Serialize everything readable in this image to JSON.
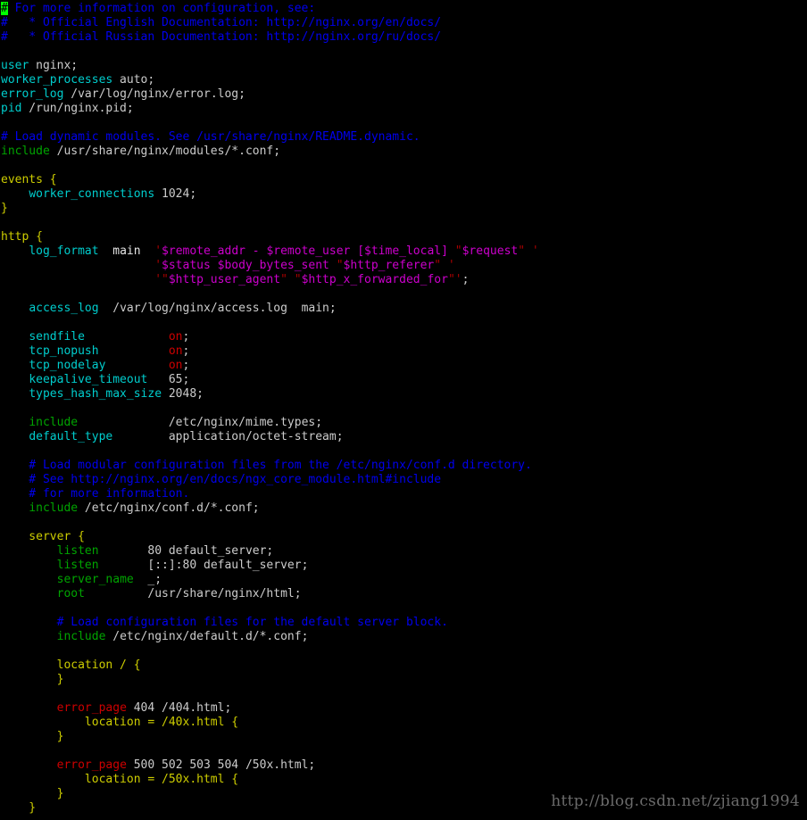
{
  "window": {
    "background_color": "#000000",
    "foreground_color": "#cccccc",
    "cursor_color": "#00ff00",
    "kind": "terminal-text-editor",
    "content_description": "nginx.conf viewed in a terminal editor with syntax highlighting"
  },
  "palette": {
    "comment": "#0000ee",
    "keyword_cyan": "#00cdcd",
    "directive_green": "#00a400",
    "block_yellow": "#cdcd00",
    "string_magenta": "#cd00cd",
    "quote_darkred": "#aa0000",
    "value_red": "#cd0000",
    "plain": "#cccccc",
    "cursor_bg": "#00ff00",
    "watermark": "#6b6b6b"
  },
  "cursor": {
    "char": "#",
    "line": 1,
    "column": 1
  },
  "watermark": {
    "text": "http://blog.csdn.net/zjiang1994"
  },
  "lines": [
    {
      "segs": [
        {
          "t": "#",
          "c": "cursor"
        },
        {
          "t": " For more information on configuration, see:",
          "c": "c-comment"
        }
      ]
    },
    {
      "segs": [
        {
          "t": "#   * Official English Documentation: http://nginx.org/en/docs/",
          "c": "c-comment"
        }
      ]
    },
    {
      "segs": [
        {
          "t": "#   * Official Russian Documentation: http://nginx.org/ru/docs/",
          "c": "c-comment"
        }
      ]
    },
    {
      "segs": [
        {
          "t": "",
          "c": "c-plain"
        }
      ]
    },
    {
      "segs": [
        {
          "t": "user",
          "c": "c-keyword"
        },
        {
          "t": " nginx;",
          "c": "c-plain"
        }
      ]
    },
    {
      "segs": [
        {
          "t": "worker_processes",
          "c": "c-keyword"
        },
        {
          "t": " auto;",
          "c": "c-plain"
        }
      ]
    },
    {
      "segs": [
        {
          "t": "error_log",
          "c": "c-keyword"
        },
        {
          "t": " /var/log/nginx/error.log;",
          "c": "c-plain"
        }
      ]
    },
    {
      "segs": [
        {
          "t": "pid",
          "c": "c-keyword"
        },
        {
          "t": " /run/nginx.pid;",
          "c": "c-plain"
        }
      ]
    },
    {
      "segs": [
        {
          "t": "",
          "c": "c-plain"
        }
      ]
    },
    {
      "segs": [
        {
          "t": "# Load dynamic modules. See /usr/share/nginx/README.dynamic.",
          "c": "c-comment"
        }
      ]
    },
    {
      "segs": [
        {
          "t": "include",
          "c": "c-green"
        },
        {
          "t": " /usr/share/nginx/modules/*.conf;",
          "c": "c-plain"
        }
      ]
    },
    {
      "segs": [
        {
          "t": "",
          "c": "c-plain"
        }
      ]
    },
    {
      "segs": [
        {
          "t": "events {",
          "c": "c-block"
        }
      ]
    },
    {
      "segs": [
        {
          "t": "    ",
          "c": "c-plain"
        },
        {
          "t": "worker_connections",
          "c": "c-keyword"
        },
        {
          "t": " 1024;",
          "c": "c-plain"
        }
      ]
    },
    {
      "segs": [
        {
          "t": "}",
          "c": "c-block"
        }
      ]
    },
    {
      "segs": [
        {
          "t": "",
          "c": "c-plain"
        }
      ]
    },
    {
      "segs": [
        {
          "t": "http {",
          "c": "c-block"
        }
      ]
    },
    {
      "segs": [
        {
          "t": "    ",
          "c": "c-plain"
        },
        {
          "t": "log_format",
          "c": "c-keyword"
        },
        {
          "t": "  main  ",
          "c": "c-white"
        },
        {
          "t": "'",
          "c": "c-quote"
        },
        {
          "t": "$remote_addr - $remote_user [$time_local] ",
          "c": "c-string"
        },
        {
          "t": "\"",
          "c": "c-quote"
        },
        {
          "t": "$request",
          "c": "c-string"
        },
        {
          "t": "\" '",
          "c": "c-quote"
        }
      ]
    },
    {
      "segs": [
        {
          "t": "                      ",
          "c": "c-plain"
        },
        {
          "t": "'",
          "c": "c-quote"
        },
        {
          "t": "$status $body_bytes_sent ",
          "c": "c-string"
        },
        {
          "t": "\"",
          "c": "c-quote"
        },
        {
          "t": "$http_referer",
          "c": "c-string"
        },
        {
          "t": "\" '",
          "c": "c-quote"
        }
      ]
    },
    {
      "segs": [
        {
          "t": "                      ",
          "c": "c-plain"
        },
        {
          "t": "'\"",
          "c": "c-quote"
        },
        {
          "t": "$http_user_agent",
          "c": "c-string"
        },
        {
          "t": "\" \"",
          "c": "c-quote"
        },
        {
          "t": "$http_x_forwarded_for",
          "c": "c-string"
        },
        {
          "t": "\"'",
          "c": "c-quote"
        },
        {
          "t": ";",
          "c": "c-plain"
        }
      ]
    },
    {
      "segs": [
        {
          "t": "",
          "c": "c-plain"
        }
      ]
    },
    {
      "segs": [
        {
          "t": "    ",
          "c": "c-plain"
        },
        {
          "t": "access_log",
          "c": "c-keyword"
        },
        {
          "t": "  /var/log/nginx/access.log  main;",
          "c": "c-plain"
        }
      ]
    },
    {
      "segs": [
        {
          "t": "",
          "c": "c-plain"
        }
      ]
    },
    {
      "segs": [
        {
          "t": "    ",
          "c": "c-plain"
        },
        {
          "t": "sendfile",
          "c": "c-keyword"
        },
        {
          "t": "            ",
          "c": "c-plain"
        },
        {
          "t": "on",
          "c": "c-value"
        },
        {
          "t": ";",
          "c": "c-plain"
        }
      ]
    },
    {
      "segs": [
        {
          "t": "    ",
          "c": "c-plain"
        },
        {
          "t": "tcp_nopush",
          "c": "c-keyword"
        },
        {
          "t": "          ",
          "c": "c-plain"
        },
        {
          "t": "on",
          "c": "c-value"
        },
        {
          "t": ";",
          "c": "c-plain"
        }
      ]
    },
    {
      "segs": [
        {
          "t": "    ",
          "c": "c-plain"
        },
        {
          "t": "tcp_nodelay",
          "c": "c-keyword"
        },
        {
          "t": "         ",
          "c": "c-plain"
        },
        {
          "t": "on",
          "c": "c-value"
        },
        {
          "t": ";",
          "c": "c-plain"
        }
      ]
    },
    {
      "segs": [
        {
          "t": "    ",
          "c": "c-plain"
        },
        {
          "t": "keepalive_timeout",
          "c": "c-keyword"
        },
        {
          "t": "   65;",
          "c": "c-plain"
        }
      ]
    },
    {
      "segs": [
        {
          "t": "    ",
          "c": "c-plain"
        },
        {
          "t": "types_hash_max_size",
          "c": "c-keyword"
        },
        {
          "t": " 2048;",
          "c": "c-plain"
        }
      ]
    },
    {
      "segs": [
        {
          "t": "",
          "c": "c-plain"
        }
      ]
    },
    {
      "segs": [
        {
          "t": "    ",
          "c": "c-plain"
        },
        {
          "t": "include",
          "c": "c-green"
        },
        {
          "t": "             /etc/nginx/mime.types;",
          "c": "c-plain"
        }
      ]
    },
    {
      "segs": [
        {
          "t": "    ",
          "c": "c-plain"
        },
        {
          "t": "default_type",
          "c": "c-keyword"
        },
        {
          "t": "        application/octet-stream;",
          "c": "c-plain"
        }
      ]
    },
    {
      "segs": [
        {
          "t": "",
          "c": "c-plain"
        }
      ]
    },
    {
      "segs": [
        {
          "t": "    # Load modular configuration files from the /etc/nginx/conf.d directory.",
          "c": "c-comment"
        }
      ]
    },
    {
      "segs": [
        {
          "t": "    # See http://nginx.org/en/docs/ngx_core_module.html#include",
          "c": "c-comment"
        }
      ]
    },
    {
      "segs": [
        {
          "t": "    # for more information.",
          "c": "c-comment"
        }
      ]
    },
    {
      "segs": [
        {
          "t": "    ",
          "c": "c-plain"
        },
        {
          "t": "include",
          "c": "c-green"
        },
        {
          "t": " /etc/nginx/conf.d/*.conf;",
          "c": "c-plain"
        }
      ]
    },
    {
      "segs": [
        {
          "t": "",
          "c": "c-plain"
        }
      ]
    },
    {
      "segs": [
        {
          "t": "    server {",
          "c": "c-block"
        }
      ]
    },
    {
      "segs": [
        {
          "t": "        ",
          "c": "c-plain"
        },
        {
          "t": "listen",
          "c": "c-green"
        },
        {
          "t": "       80 default_server;",
          "c": "c-plain"
        }
      ]
    },
    {
      "segs": [
        {
          "t": "        ",
          "c": "c-plain"
        },
        {
          "t": "listen",
          "c": "c-green"
        },
        {
          "t": "       [::]:80 default_server;",
          "c": "c-plain"
        }
      ]
    },
    {
      "segs": [
        {
          "t": "        ",
          "c": "c-plain"
        },
        {
          "t": "server_name",
          "c": "c-green"
        },
        {
          "t": "  _;",
          "c": "c-plain"
        }
      ]
    },
    {
      "segs": [
        {
          "t": "        ",
          "c": "c-plain"
        },
        {
          "t": "root",
          "c": "c-green"
        },
        {
          "t": "         /usr/share/nginx/html;",
          "c": "c-plain"
        }
      ]
    },
    {
      "segs": [
        {
          "t": "",
          "c": "c-plain"
        }
      ]
    },
    {
      "segs": [
        {
          "t": "        # Load configuration files for the default server block.",
          "c": "c-comment"
        }
      ]
    },
    {
      "segs": [
        {
          "t": "        ",
          "c": "c-plain"
        },
        {
          "t": "include",
          "c": "c-green"
        },
        {
          "t": " /etc/nginx/default.d/*.conf;",
          "c": "c-plain"
        }
      ]
    },
    {
      "segs": [
        {
          "t": "",
          "c": "c-plain"
        }
      ]
    },
    {
      "segs": [
        {
          "t": "        location / {",
          "c": "c-block"
        }
      ]
    },
    {
      "segs": [
        {
          "t": "        }",
          "c": "c-block"
        }
      ]
    },
    {
      "segs": [
        {
          "t": "",
          "c": "c-plain"
        }
      ]
    },
    {
      "segs": [
        {
          "t": "        ",
          "c": "c-plain"
        },
        {
          "t": "error_page",
          "c": "c-errpage"
        },
        {
          "t": " 404 /404.html;",
          "c": "c-plain"
        }
      ]
    },
    {
      "segs": [
        {
          "t": "            location = /40x.html {",
          "c": "c-block"
        }
      ]
    },
    {
      "segs": [
        {
          "t": "        }",
          "c": "c-block"
        }
      ]
    },
    {
      "segs": [
        {
          "t": "",
          "c": "c-plain"
        }
      ]
    },
    {
      "segs": [
        {
          "t": "        ",
          "c": "c-plain"
        },
        {
          "t": "error_page",
          "c": "c-errpage"
        },
        {
          "t": " 500 502 503 504 /50x.html;",
          "c": "c-plain"
        }
      ]
    },
    {
      "segs": [
        {
          "t": "            location = /50x.html {",
          "c": "c-block"
        }
      ]
    },
    {
      "segs": [
        {
          "t": "        }",
          "c": "c-block"
        }
      ]
    },
    {
      "segs": [
        {
          "t": "    }",
          "c": "c-block"
        }
      ]
    }
  ]
}
